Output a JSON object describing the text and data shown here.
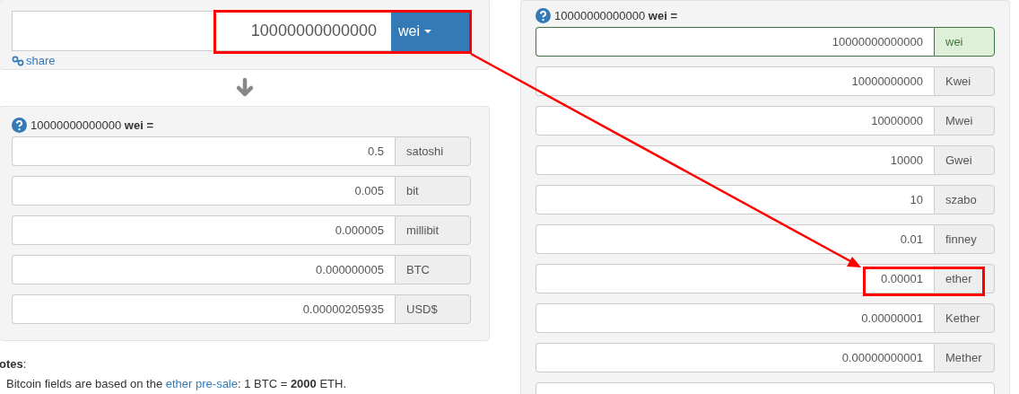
{
  "converter": {
    "value": "10000000000000",
    "unit": "wei",
    "share_link": "share"
  },
  "bitcoin_panel": {
    "heading": "10000000000000 **wei =**",
    "rows": [
      {
        "value": "0.5",
        "unit": "satoshi"
      },
      {
        "value": "0.005",
        "unit": "bit"
      },
      {
        "value": "0.000005",
        "unit": "millibit"
      },
      {
        "value": "0.000000005",
        "unit": "BTC"
      },
      {
        "value": "0.00000205935",
        "unit": "USD$"
      }
    ]
  },
  "notes": {
    "title": "**otes**:",
    "text_before": "Bitcoin fields are based on the ",
    "link": "ether pre-sale",
    "text_after": ": 1 BTC = **2000** ETH."
  },
  "ether_panel": {
    "heading": "10000000000000 **wei =**",
    "rows": [
      {
        "value": "10000000000000",
        "unit": "wei",
        "selected": true
      },
      {
        "value": "10000000000",
        "unit": "Kwei",
        "selected": false
      },
      {
        "value": "10000000",
        "unit": "Mwei",
        "selected": false
      },
      {
        "value": "10000",
        "unit": "Gwei",
        "selected": false
      },
      {
        "value": "10",
        "unit": "szabo",
        "selected": false
      },
      {
        "value": "0.01",
        "unit": "finney",
        "selected": false
      },
      {
        "value": "0.00001",
        "unit": "ether",
        "selected": false
      },
      {
        "value": "0.00000001",
        "unit": "Kether",
        "selected": false
      },
      {
        "value": "0.00000000001",
        "unit": "Mether",
        "selected": false
      }
    ]
  }
}
